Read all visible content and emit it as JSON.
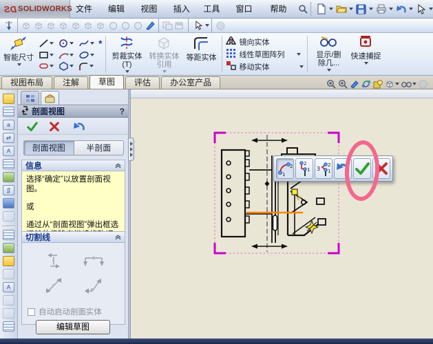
{
  "window": {
    "logo_mark": "DS",
    "logo_word": "SOLIDWORKS"
  },
  "menubar": {
    "items": [
      "文件(F)",
      "编辑(E)",
      "视图(V)",
      "插入(I)",
      "工具(T)",
      "窗口(W)",
      "帮助(H)"
    ]
  },
  "ribbon": {
    "smart_dimension": "智能尺寸",
    "trim": "剪裁实体(T)",
    "convert": "转换实体引用",
    "offset": "等距实体",
    "mirror": "镜向实体",
    "linear_pattern": "线性草图阵列",
    "move": "移动实体",
    "display_delete": "显示/删除几...",
    "quick_snaps": "快速捕捉"
  },
  "tabs": {
    "items": [
      "视图布局",
      "注解",
      "草图",
      "评估",
      "办公室产品"
    ],
    "active": "草图"
  },
  "property_manager": {
    "title": "剖面视图",
    "help": "?",
    "modes": [
      "剖面视图",
      "半剖面"
    ],
    "info_header": "信息",
    "messages": [
      "选择“确定”以放置剖面视图。",
      "或",
      "通过从“剖面视图”弹出框选择其他偏移来继续修改切割线。"
    ],
    "cutting_line_header": "切割线",
    "auto_start_label": "自动启动剖面实体",
    "edit_sketch_label": "编辑草图"
  },
  "popup": {
    "digits": {
      "one": "1",
      "two": "2",
      "three": "3"
    }
  },
  "colors": {
    "selection_magenta": "#cc00cc",
    "highlight_pink": "#f3688e",
    "cutting_line_orange": "#ff8400",
    "message_yellow": "#ffffc6",
    "marker_yellow": "#ffe92a"
  }
}
